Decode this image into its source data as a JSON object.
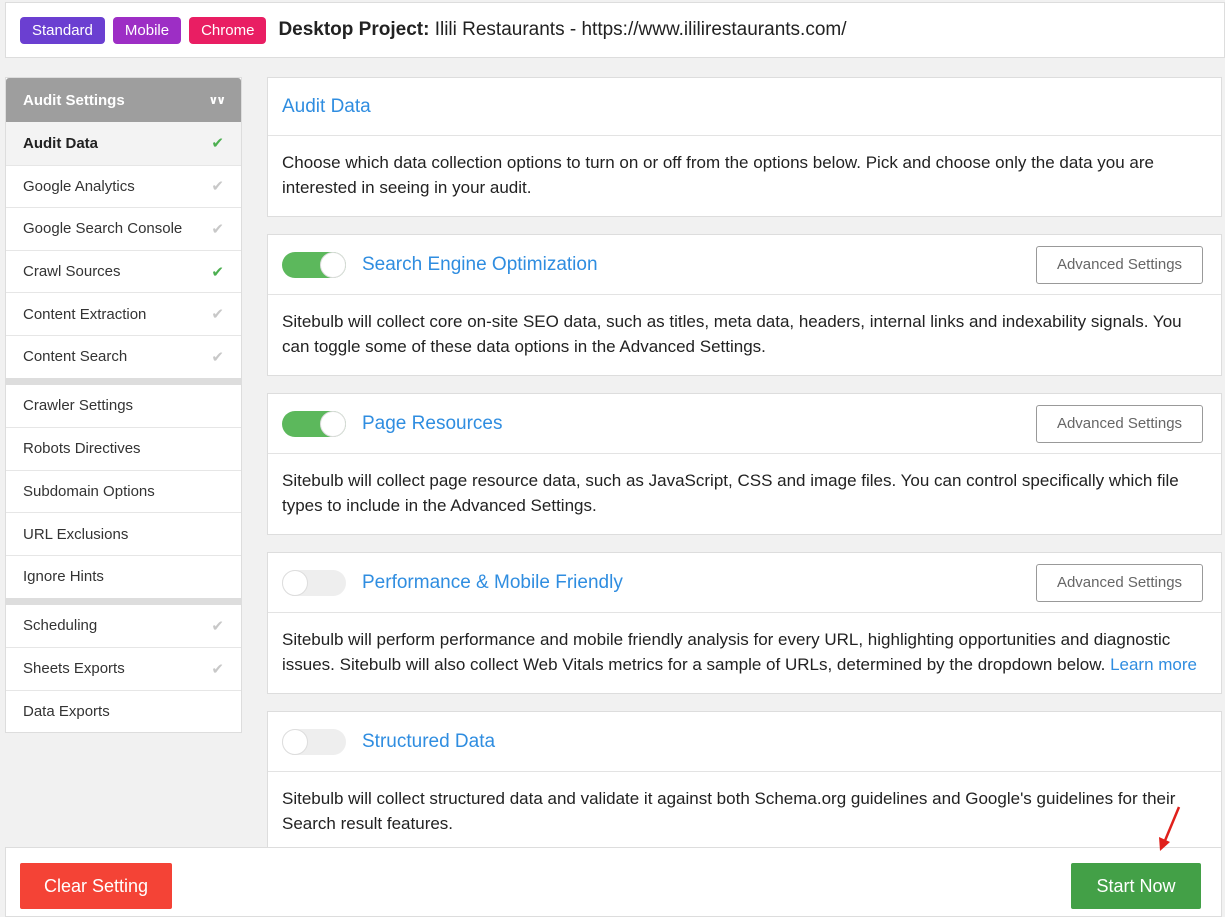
{
  "header": {
    "badges": [
      "Standard",
      "Mobile",
      "Chrome"
    ],
    "project_label": "Desktop Project:",
    "project_value": "Ilili Restaurants - https://www.ililirestaurants.com/"
  },
  "sidebar": {
    "title": "Audit Settings",
    "group1": [
      {
        "label": "Audit Data",
        "check": "✔"
      },
      {
        "label": "Google Analytics",
        "check": "✔"
      },
      {
        "label": "Google Search Console",
        "check": "✔"
      },
      {
        "label": "Crawl Sources",
        "check": "✔"
      },
      {
        "label": "Content Extraction",
        "check": "✔"
      },
      {
        "label": "Content Search",
        "check": "✔"
      }
    ],
    "group2": [
      {
        "label": "Crawler Settings"
      },
      {
        "label": "Robots Directives"
      },
      {
        "label": "Subdomain Options"
      },
      {
        "label": "URL Exclusions"
      },
      {
        "label": "Ignore Hints"
      }
    ],
    "group3": [
      {
        "label": "Scheduling",
        "check": "✔"
      },
      {
        "label": "Sheets Exports",
        "check": "✔"
      },
      {
        "label": "Data Exports"
      }
    ]
  },
  "main": {
    "intro": {
      "title": "Audit Data",
      "body": "Choose which data collection options to turn on or off from the options below. Pick and choose only the data you are interested in seeing in your audit."
    },
    "sections": [
      {
        "title": "Search Engine Optimization",
        "enabled": true,
        "button": "Advanced Settings",
        "body": "Sitebulb will collect core on-site SEO data, such as titles, meta data, headers, internal links and indexability signals. You can toggle some of these data options in the Advanced Settings."
      },
      {
        "title": "Page Resources",
        "enabled": true,
        "button": "Advanced Settings",
        "body": "Sitebulb will collect page resource data, such as JavaScript, CSS and image files. You can control specifically which file types to include in the Advanced Settings."
      },
      {
        "title": "Performance & Mobile Friendly",
        "enabled": false,
        "button": "Advanced Settings",
        "body": "Sitebulb will perform performance and mobile friendly analysis for every URL, highlighting opportunities and diagnostic issues. Sitebulb will also collect Web Vitals metrics for a sample of URLs, determined by the dropdown below.",
        "link": "Learn more"
      },
      {
        "title": "Structured Data",
        "enabled": false,
        "body": "Sitebulb will collect structured data and validate it against both Schema.org guidelines and Google's guidelines for their Search result features."
      }
    ]
  },
  "footer": {
    "clear_label": "Clear Setting",
    "start_label": "Start Now"
  },
  "colors": {
    "accent_blue": "#2f8de0",
    "toggle_on": "#5cb85c",
    "clear_red": "#f44336",
    "start_green": "#43a047"
  }
}
